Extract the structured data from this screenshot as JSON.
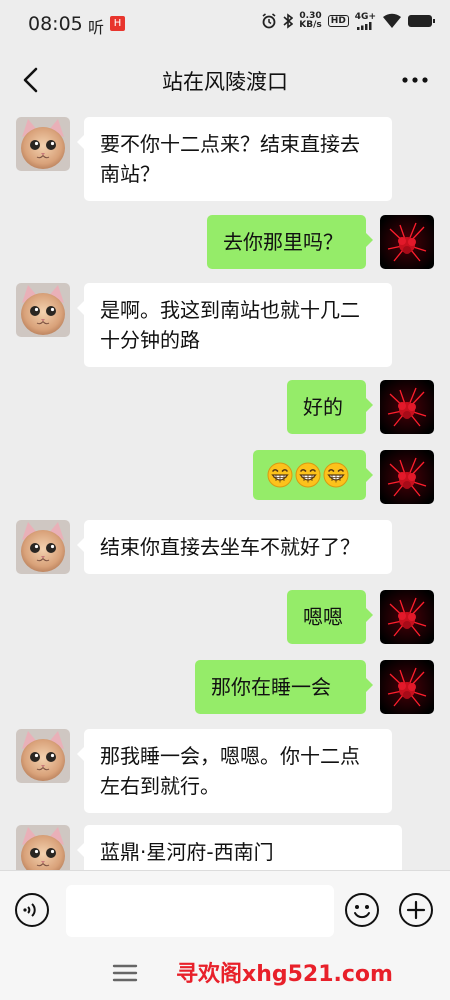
{
  "status_bar": {
    "time": "08:05",
    "app_text": "听",
    "badge": "H",
    "speed_value": "0.30",
    "speed_unit": "KB/s",
    "hd": "HD",
    "network": "4G+"
  },
  "header": {
    "title": "站在风陵渡口"
  },
  "messages": [
    {
      "side": "in",
      "text": "要不你十二点来？结束直接去南站？"
    },
    {
      "side": "out",
      "text": "去你那里吗？"
    },
    {
      "side": "in",
      "text": "是啊。我这到南站也就十几二十分钟的路"
    },
    {
      "side": "out",
      "text": "好的"
    },
    {
      "side": "out",
      "emoji": [
        "grinning-face",
        "grinning-face",
        "grinning-face"
      ]
    },
    {
      "side": "in",
      "text": "结束你直接去坐车不就好了？"
    },
    {
      "side": "out",
      "text": "嗯嗯"
    },
    {
      "side": "out",
      "text": "那你在睡一会"
    },
    {
      "side": "in",
      "text": "那我睡一会，嗯嗯。你十二点左右到就行。"
    },
    {
      "side": "in",
      "text": "蓝鼎·星河府-西南门"
    }
  ],
  "footer": {
    "watermark": "寻欢阁xhg521.com"
  },
  "colors": {
    "background": "#ededed",
    "outgoing_bubble": "#95ec69",
    "incoming_bubble": "#ffffff",
    "watermark": "#e8202a"
  }
}
